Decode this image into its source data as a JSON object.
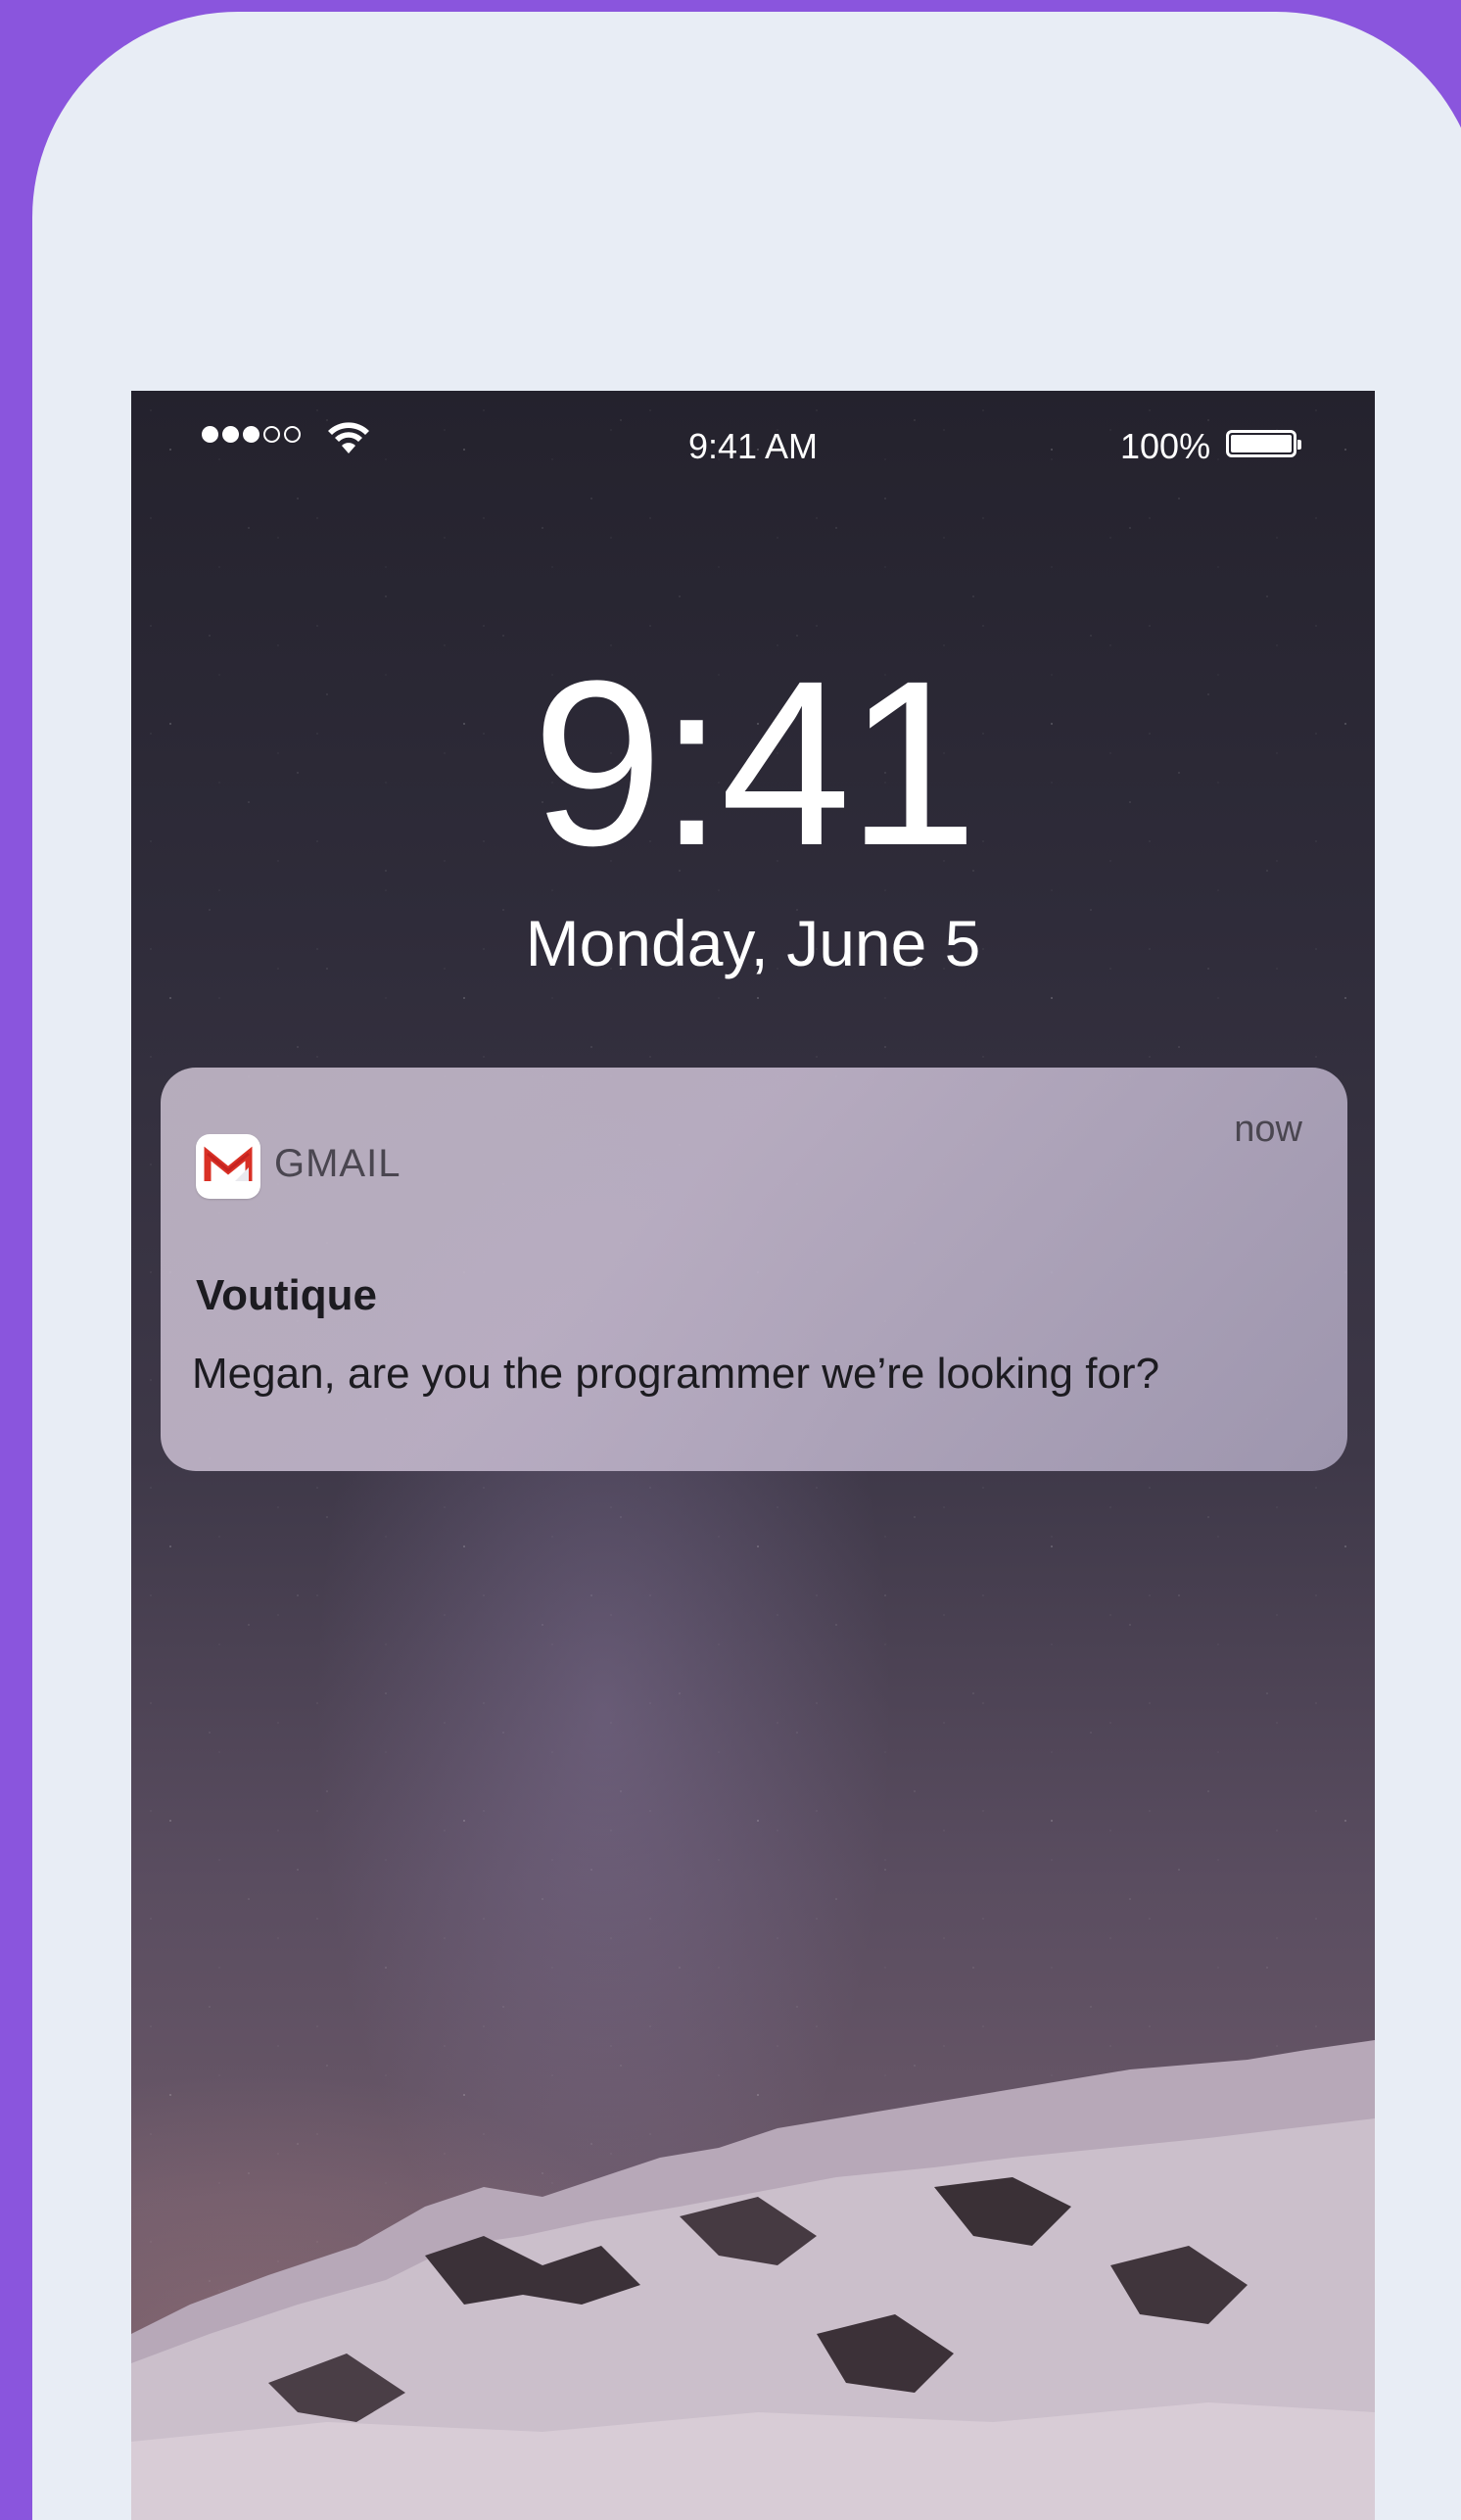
{
  "status_bar": {
    "signal_dots_filled": 3,
    "signal_dots_total": 5,
    "time": "9:41 AM",
    "battery_percent": "100%",
    "battery_level": 1.0
  },
  "lock_screen": {
    "clock": "9:41",
    "date": "Monday, June 5"
  },
  "notification": {
    "app_icon": "gmail-icon",
    "app_name": "GMAIL",
    "time": "now",
    "title": "Voutique",
    "body": "Megan, are you the programmer we’re looking for?"
  },
  "colors": {
    "background": "#8a55dd",
    "frame": "#e8edf5",
    "gmail_red": "#d93025"
  }
}
